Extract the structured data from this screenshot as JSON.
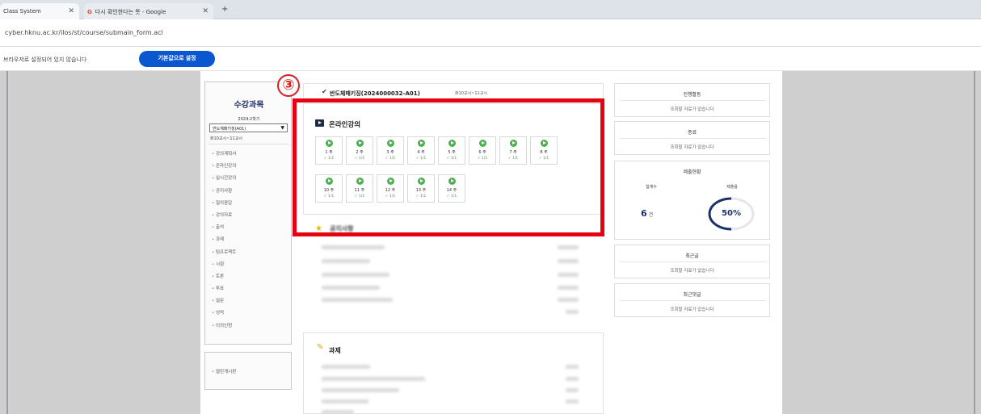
{
  "browser": {
    "tabs": [
      {
        "label": "Class System",
        "close": "✕"
      },
      {
        "label": "다시 확인한다는 뜻 - Google",
        "close": "✕"
      }
    ],
    "new_tab": "+",
    "url": "cyber.hknu.ac.kr/ilos/st/course/submain_form.acl",
    "infobar_text": "브라우저로 설정되어 있지 않습니다",
    "infobar_button": "기본값으로 설정"
  },
  "sidebar": {
    "title": "수강과목",
    "term": "2024-2학기",
    "course_select": "반도체패키징(A01)",
    "schedule": "화10교시~11교시",
    "menu": [
      "강의계획서",
      "온라인강의",
      "실시간강의",
      "공지사항",
      "질의응답",
      "강의자료",
      "출석",
      "과제",
      "팀프로젝트",
      "시험",
      "토론",
      "투표",
      "설문",
      "성적",
      "이의신청"
    ],
    "extra": "열린게시판"
  },
  "course": {
    "check": "✔",
    "name": "반도체패키징(2024000032-A01)",
    "time": "화10교시~11교시"
  },
  "annotation": {
    "marker": "③"
  },
  "lectures": {
    "title": "온라인강의",
    "weeks": [
      {
        "label": "1 주",
        "status": "✓ 1/1"
      },
      {
        "label": "2 주",
        "status": "✓ 1/1"
      },
      {
        "label": "3 주",
        "status": "✓ 1/1"
      },
      {
        "label": "4 주",
        "status": "✓ 1/1"
      },
      {
        "label": "5 주",
        "status": "✓ 1/1"
      },
      {
        "label": "6 주",
        "status": "✓ 1/1"
      },
      {
        "label": "7 주",
        "status": "✓ 1/1"
      },
      {
        "label": "8 주",
        "status": "✓ 1/1"
      },
      {
        "label": "10 주",
        "status": "✓ 1/1"
      },
      {
        "label": "11 주",
        "status": "✓ 1/1"
      },
      {
        "label": "12 주",
        "status": "✓ 1/1"
      },
      {
        "label": "13 주",
        "status": "✓ 1/1"
      },
      {
        "label": "14 주",
        "status": "✓ 1/1"
      }
    ]
  },
  "notices": {
    "title": "공지사항"
  },
  "assignments": {
    "title": "과제"
  },
  "right": {
    "activity": {
      "title": "진행활동",
      "empty": "조회할 자료가 없습니다"
    },
    "todo": {
      "title": "종료",
      "empty": "조회할 자료가 없습니다"
    },
    "submission": {
      "title": "제출현황",
      "count_label": "합계수",
      "rate_label": "제출률",
      "count": "6",
      "count_unit": "건",
      "rate": "50%",
      "rate_value": 0.5,
      "ring_color": "#1d2f6b"
    },
    "recent_posts": {
      "title": "최근글",
      "empty": "조회할 자료가 없습니다"
    },
    "recent_comments": {
      "title": "최근댓글",
      "empty": "조회할 자료가 없습니다"
    }
  },
  "colors": {
    "accent": "#0b57d0",
    "highlight": "#e60012",
    "navy": "#1d2f6b",
    "complete": "#3a9b3a"
  }
}
